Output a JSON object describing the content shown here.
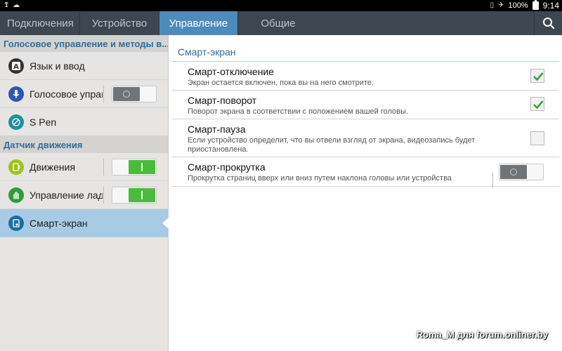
{
  "status_bar": {
    "battery": "100%",
    "time": "9:14"
  },
  "tabs": [
    {
      "label": "Подключения"
    },
    {
      "label": "Устройство"
    },
    {
      "label": "Управление"
    },
    {
      "label": "Общие"
    }
  ],
  "left_pane": {
    "section1": "Голосовое управление и методы в...",
    "items1": [
      {
        "label": "Язык и ввод"
      },
      {
        "label": "Голосовое управление",
        "toggle": "off"
      },
      {
        "label": "S Pen"
      }
    ],
    "section2": "Датчик движения",
    "items2": [
      {
        "label": "Движения",
        "toggle": "on"
      },
      {
        "label": "Управление ладонью",
        "toggle": "on"
      },
      {
        "label": "Смарт-экран",
        "selected": true
      }
    ]
  },
  "right_pane": {
    "title": "Смарт-экран",
    "items": [
      {
        "title": "Смарт-отключение",
        "subtitle": "Экран остается включен, пока вы на него смотрите.",
        "control": "checkbox",
        "checked": true
      },
      {
        "title": "Смарт-поворот",
        "subtitle": "Поворот экрана в соответствии с положением вашей головы.",
        "control": "checkbox",
        "checked": true
      },
      {
        "title": "Смарт-пауза",
        "subtitle": "Если устройство определит, что вы отвели взгляд от экрана, видеозапись будет приостановлена.",
        "control": "checkbox",
        "checked": false
      },
      {
        "title": "Смарт-прокрутка",
        "subtitle": "Прокрутка страниц вверх или вниз путем наклона головы или устройства",
        "control": "switch",
        "checked": false
      }
    ]
  },
  "watermark": "Roma_M для forum.onliner.by",
  "colors": {
    "accent": "#4c8bbb",
    "toggle_on": "#4cbb3d",
    "check": "#3aa33a"
  }
}
